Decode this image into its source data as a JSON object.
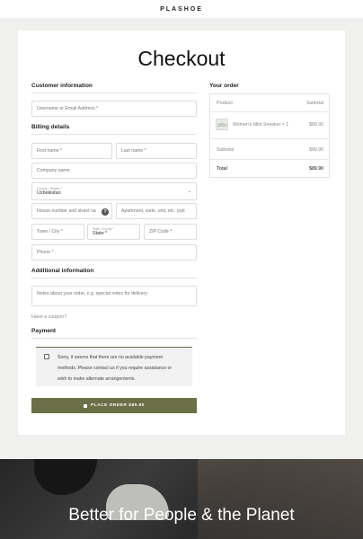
{
  "header": {
    "brand": "PLASHOE"
  },
  "checkout": {
    "title": "Checkout",
    "customer_info": {
      "heading": "Customer information",
      "email_placeholder": "Username or Email Address *"
    },
    "billing": {
      "heading": "Billing details",
      "first_name": "First name *",
      "last_name": "Last name *",
      "company": "Company name",
      "country_label": "Country / Region *",
      "country_value": "Uzbekistan",
      "house_number": "House number and street na",
      "apartment": "Apartment, suite, unit, etc. (opt",
      "city": "Town / City *",
      "state_label": "State / County *",
      "state_value": "State *",
      "zip": "ZIP Code *",
      "phone": "Phone *"
    },
    "additional": {
      "heading": "Additional information",
      "notes_placeholder": "Notes about your order, e.g. special notes for delivery."
    },
    "coupon_link": "Have a coupon?",
    "payment": {
      "heading": "Payment",
      "notice_line1": "Sorry, it seems that there are no available payment",
      "notice_line2": "methods. Please contact us if you require assistance or",
      "notice_line3": "wish to make alternate arrangements.",
      "place_order": "PLACE ORDER $89.90"
    },
    "order": {
      "heading": "Your order",
      "col_product": "Product",
      "col_subtotal": "Subtotal",
      "item_name": "Women's Mint Sneaker × 1",
      "item_price": "$89.90",
      "subtotal_label": "Subtotal",
      "subtotal_value": "$89.90",
      "total_label": "Total",
      "total_value": "$89.90"
    }
  },
  "hero": {
    "tagline": "Better for People & the Planet"
  },
  "colors": {
    "accent": "#6b6f47",
    "background": "#f0f0ee",
    "card": "#ffffff"
  },
  "icons": {
    "info": "info-icon",
    "lock": "lock-icon",
    "notice": "notice-icon",
    "chevron": "chevron-down-icon"
  }
}
